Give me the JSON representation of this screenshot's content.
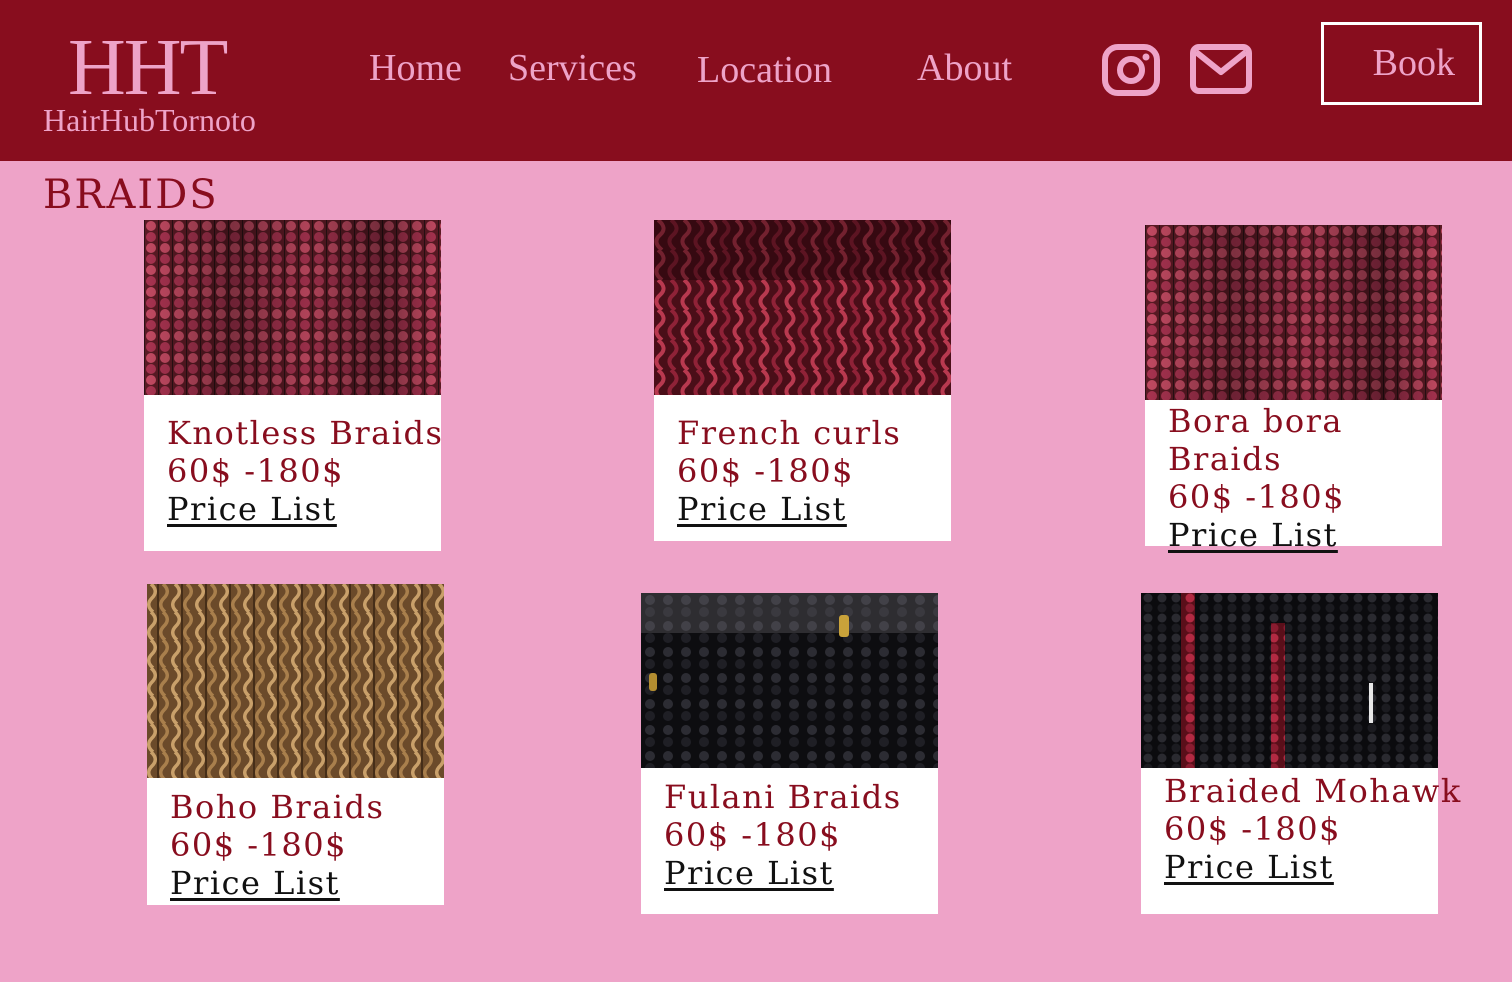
{
  "brand": {
    "mark": "HHT",
    "name": "HairHubTornoto"
  },
  "nav": {
    "home": "Home",
    "services": "Services",
    "location": "Location",
    "about": "About"
  },
  "book_button": "Book",
  "icons": {
    "instagram": "instagram-icon",
    "mail": "mail-icon"
  },
  "colors": {
    "header": "#880d1e",
    "background": "#eea3c8",
    "accent_text": "#eea3c8",
    "card": "#ffffff"
  },
  "section": {
    "title": "BRAIDS"
  },
  "services": [
    {
      "name": "Knotless Braids",
      "price": "60$ -180$",
      "link": "Price List",
      "photo": "pink-black-box-braids"
    },
    {
      "name": "French curls",
      "price": "60$ -180$",
      "link": "Price List",
      "photo": "burgundy-curly-braids"
    },
    {
      "name": "Bora bora Braids",
      "price": "60$ -180$",
      "link": "Price List",
      "photo": "pink-black-box-braids"
    },
    {
      "name": "Boho Braids",
      "price": "60$ -180$",
      "link": "Price List",
      "photo": "blonde-boho-braids"
    },
    {
      "name": "Fulani Braids",
      "price": "60$ -180$",
      "link": "Price List",
      "photo": "black-fulani-braids"
    },
    {
      "name": "Braided Mohawk",
      "price": "60$ -180$",
      "link": "Price List",
      "photo": "black-red-mohawk-braids"
    }
  ]
}
